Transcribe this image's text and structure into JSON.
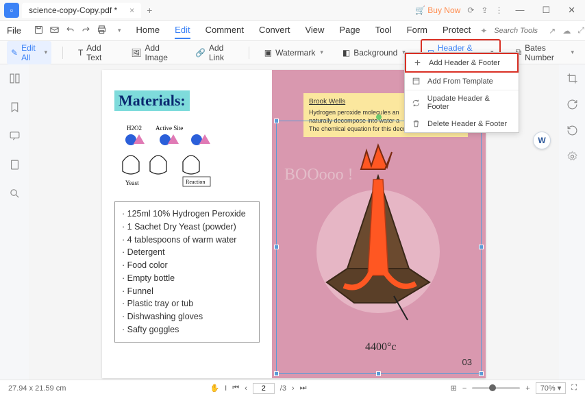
{
  "titlebar": {
    "doc_name": "science-copy-Copy.pdf *",
    "buy_now": "Buy Now"
  },
  "menubar": {
    "file": "File",
    "tabs": [
      "Home",
      "Edit",
      "Comment",
      "Convert",
      "View",
      "Page",
      "Tool",
      "Form",
      "Protect"
    ],
    "active_tab": "Edit",
    "search_placeholder": "Search Tools"
  },
  "toolbar": {
    "edit_all": "Edit All",
    "add_text": "Add Text",
    "add_image": "Add Image",
    "add_link": "Add Link",
    "watermark": "Watermark",
    "background": "Background",
    "header_footer": "Header & Footer",
    "bates_number": "Bates Number"
  },
  "dropdown": {
    "items": [
      "Add Header & Footer",
      "Add From Template",
      "Upadate Header & Footer",
      "Delete Header & Footer"
    ]
  },
  "page_content": {
    "materials_title": "Materials:",
    "diagram_labels": {
      "h2o2": "H2O2",
      "active_site": "Active Site",
      "yeast": "Yeast",
      "reaction": "Reaction"
    },
    "materials_list": [
      "125ml 10% Hydrogen Peroxide",
      "1 Sachet Dry Yeast (powder)",
      "4 tablespoons of warm water",
      "Detergent",
      "Food color",
      "Empty bottle",
      "Funnel",
      "Plastic tray or tub",
      "Dishwashing gloves",
      "Safty goggles"
    ],
    "sticky": {
      "author": "Brook Wells",
      "line1": "Hydrogen peroxide molecules an",
      "line2": "naturally decompose into water a",
      "line3": "The chemical equation for this decomposition is:"
    },
    "boo_text": "BOOooo !",
    "temperature": "4400°c",
    "page_number": "03"
  },
  "statusbar": {
    "dimensions": "27.94 x 21.59 cm",
    "page_current": "2",
    "page_total": "/3",
    "zoom": "70%"
  }
}
